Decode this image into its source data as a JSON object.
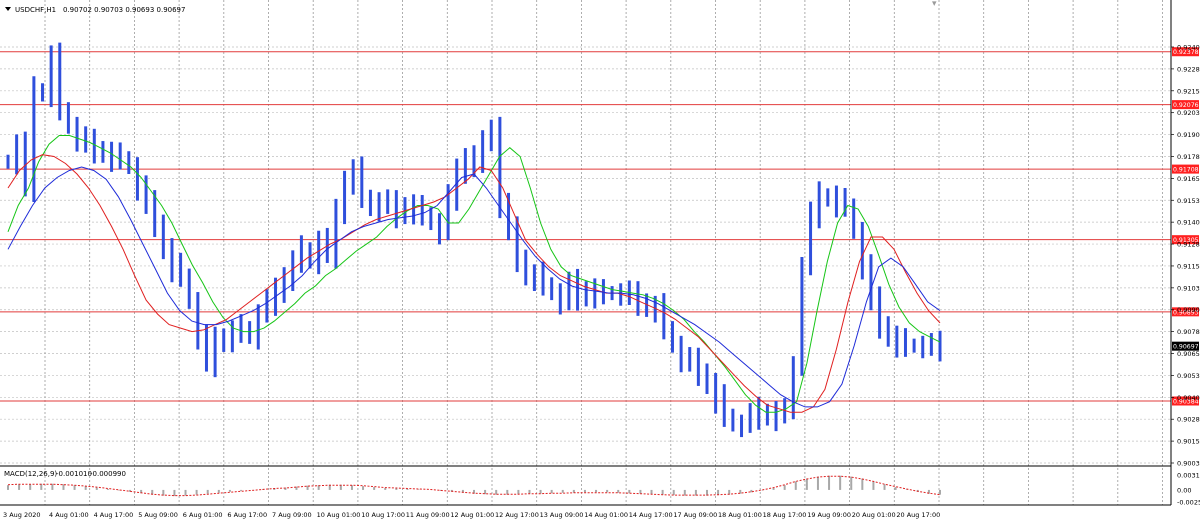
{
  "header": {
    "symbol_tf": "USDCHF,H1",
    "ohlc": "0.90702 0.90703 0.90693 0.90697"
  },
  "macd_header": {
    "label": "MACD(12,26,9)",
    "main": "-0.001010",
    "signal": "-0.000990"
  },
  "colors": {
    "background": "#ffffff",
    "grid": "#c0c0c0",
    "candles": "#2f4fdc",
    "sr_lines": "#e23b3b",
    "sr_label_bg": "#ff2020",
    "current_price_bg": "#000000",
    "ma_fast": "#16c516",
    "ma_mid": "#e02020",
    "ma_slow": "#1e2bd8",
    "macd_hist": "#a8a8a8",
    "macd_signal": "#e02020"
  },
  "chart_data": [
    {
      "type": "line",
      "title": "USDCHF,H1",
      "x_tick_labels": [
        "3 Aug 2020",
        "4 Aug 01:00",
        "4 Aug 17:00",
        "5 Aug 09:00",
        "6 Aug 01:00",
        "6 Aug 17:00",
        "7 Aug 09:00",
        "10 Aug 01:00",
        "10 Aug 17:00",
        "11 Aug 09:00",
        "12 Aug 01:00",
        "12 Aug 17:00",
        "13 Aug 09:00",
        "14 Aug 01:00",
        "14 Aug 17:00",
        "17 Aug 09:00",
        "18 Aug 01:00",
        "18 Aug 17:00",
        "19 Aug 09:00",
        "20 Aug 01:00",
        "20 Aug 17:00"
      ],
      "y_tick_labels": [
        "0.92405",
        "0.92280",
        "0.92155",
        "0.92030",
        "0.91905",
        "0.91780",
        "0.91655",
        "0.91530",
        "0.91405",
        "0.91280",
        "0.91155",
        "0.91030",
        "0.90905",
        "0.90780",
        "0.90655",
        "0.90530",
        "0.90405",
        "0.90280",
        "0.90155",
        "0.90030"
      ],
      "ylim": [
        0.9003,
        0.92405
      ],
      "grid": true,
      "horizontal_levels": [
        0.92378,
        0.92076,
        0.91708,
        0.91305,
        0.90893,
        0.90384
      ],
      "current_price": 0.90697,
      "series": [
        {
          "name": "price",
          "style": "bars",
          "values": [
            0.9175,
            0.9185,
            0.916,
            0.9215,
            0.9215,
            0.9235,
            0.9205,
            0.9195,
            0.9188,
            0.9185,
            0.9182,
            0.918,
            0.9178,
            0.9177,
            0.9172,
            0.916,
            0.915,
            0.914,
            0.9125,
            0.9115,
            0.911,
            0.9095,
            0.9075,
            0.906,
            0.9072,
            0.9075,
            0.9078,
            0.908,
            0.9075,
            0.9088,
            0.9095,
            0.91,
            0.911,
            0.9118,
            0.9125,
            0.9118,
            0.913,
            0.9122,
            0.9145,
            0.9165,
            0.917,
            0.9155,
            0.9148,
            0.9152,
            0.915,
            0.9145,
            0.915,
            0.9148,
            0.9145,
            0.914,
            0.9135,
            0.9155,
            0.9168,
            0.9178,
            0.9175,
            0.9185,
            0.9195,
            0.915,
            0.9135,
            0.912,
            0.911,
            0.911,
            0.9105,
            0.91,
            0.9095,
            0.9105,
            0.9098,
            0.9102,
            0.91,
            0.91,
            0.91,
            0.91,
            0.9098,
            0.9095,
            0.9092,
            0.9092,
            0.908,
            0.907,
            0.9062,
            0.906,
            0.9055,
            0.9048,
            0.904,
            0.903,
            0.9025,
            0.9025,
            0.903,
            0.9032,
            0.903,
            0.9032,
            0.9032,
            0.906,
            0.9115,
            0.9145,
            0.9155,
            0.9155,
            0.9152,
            0.915,
            0.9135,
            0.9115,
            0.9095,
            0.9082,
            0.9075,
            0.9072,
            0.907,
            0.907,
            0.907,
            0.9069,
            0.90697
          ]
        },
        {
          "name": "MA fast",
          "color": "#16c516",
          "values": [
            0.9135,
            0.915,
            0.916,
            0.9175,
            0.9185,
            0.919,
            0.919,
            0.9188,
            0.9186,
            0.9183,
            0.918,
            0.9176,
            0.9172,
            0.9166,
            0.9158,
            0.915,
            0.914,
            0.9128,
            0.9116,
            0.9106,
            0.9095,
            0.9086,
            0.908,
            0.9078,
            0.9078,
            0.908,
            0.9084,
            0.9089,
            0.9094,
            0.91,
            0.9104,
            0.911,
            0.9114,
            0.9119,
            0.9124,
            0.9128,
            0.9132,
            0.9138,
            0.9143,
            0.9147,
            0.915,
            0.915,
            0.9148,
            0.914,
            0.914,
            0.9148,
            0.9158,
            0.9168,
            0.9178,
            0.9183,
            0.9178,
            0.916,
            0.914,
            0.9125,
            0.9115,
            0.911,
            0.9108,
            0.9106,
            0.9104,
            0.9102,
            0.9101,
            0.91,
            0.9099,
            0.9097,
            0.9094,
            0.909,
            0.9085,
            0.9078,
            0.9072,
            0.9065,
            0.9058,
            0.905,
            0.9042,
            0.9036,
            0.9032,
            0.9032,
            0.9034,
            0.9038,
            0.906,
            0.909,
            0.9118,
            0.914,
            0.915,
            0.9148,
            0.9138,
            0.9122,
            0.9105,
            0.9092,
            0.9083,
            0.9078,
            0.9075,
            0.9072
          ]
        },
        {
          "name": "MA mid",
          "color": "#e02020",
          "values": [
            0.916,
            0.917,
            0.9176,
            0.9179,
            0.9178,
            0.9174,
            0.9168,
            0.916,
            0.915,
            0.9138,
            0.9125,
            0.911,
            0.9096,
            0.9088,
            0.9082,
            0.908,
            0.9078,
            0.9079,
            0.9082,
            0.9085,
            0.909,
            0.9095,
            0.91,
            0.9105,
            0.911,
            0.9115,
            0.912,
            0.9124,
            0.9128,
            0.9131,
            0.9135,
            0.9139,
            0.9142,
            0.9144,
            0.9146,
            0.9148,
            0.915,
            0.9152,
            0.9155,
            0.916,
            0.9165,
            0.9172,
            0.917,
            0.916,
            0.9145,
            0.913,
            0.9122,
            0.9115,
            0.911,
            0.9107,
            0.9104,
            0.9102,
            0.91,
            0.91,
            0.9098,
            0.9095,
            0.9092,
            0.9089,
            0.9085,
            0.908,
            0.9075,
            0.9068,
            0.9061,
            0.9054,
            0.9047,
            0.9041,
            0.9036,
            0.9034,
            0.9032,
            0.9032,
            0.9035,
            0.9045,
            0.9068,
            0.9095,
            0.9118,
            0.9132,
            0.9132,
            0.9125,
            0.9112,
            0.91,
            0.909,
            0.9083
          ]
        },
        {
          "name": "MA slow",
          "color": "#1e2bd8",
          "values": [
            0.9125,
            0.9138,
            0.915,
            0.916,
            0.9166,
            0.917,
            0.9172,
            0.917,
            0.9165,
            0.9155,
            0.9142,
            0.9128,
            0.9114,
            0.91,
            0.909,
            0.9084,
            0.9082,
            0.9082,
            0.9084,
            0.9087,
            0.909,
            0.9094,
            0.9099,
            0.9104,
            0.911,
            0.9118,
            0.9125,
            0.913,
            0.9135,
            0.9138,
            0.914,
            0.9142,
            0.9143,
            0.9144,
            0.9146,
            0.915,
            0.9158,
            0.9166,
            0.9168,
            0.916,
            0.915,
            0.914,
            0.913,
            0.9121,
            0.9114,
            0.9108,
            0.9104,
            0.9102,
            0.9101,
            0.91,
            0.91,
            0.9099,
            0.9097,
            0.9094,
            0.909,
            0.9086,
            0.9082,
            0.9077,
            0.9072,
            0.9066,
            0.906,
            0.9054,
            0.9048,
            0.9042,
            0.9038,
            0.9035,
            0.9035,
            0.9038,
            0.9048,
            0.907,
            0.9095,
            0.9115,
            0.912,
            0.9115,
            0.9105,
            0.9095,
            0.909
          ]
        }
      ]
    },
    {
      "type": "bar",
      "title": "MACD(12,26,9)",
      "y_tick_labels": [
        "0.00315",
        "0.00",
        "-0.00255"
      ],
      "ylim": [
        -0.00255,
        0.00315
      ],
      "grid": true,
      "series": [
        {
          "name": "main",
          "style": "histogram",
          "values": [
            0.001,
            0.0012,
            0.0012,
            0.0013,
            0.0013,
            0.0012,
            0.001,
            0.0008,
            0.0005,
            0.0002,
            -0.0001,
            -0.0004,
            -0.0007,
            -0.001,
            -0.0012,
            -0.0013,
            -0.0012,
            -0.001,
            -0.0008,
            -0.0006,
            -0.0004,
            -0.0002,
            0.0,
            0.0002,
            0.0004,
            0.0005,
            0.0007,
            0.0009,
            0.001,
            0.0011,
            0.0011,
            0.001,
            0.0008,
            0.0006,
            0.0004,
            0.0003,
            0.0002,
            0.0001,
            0.0,
            -0.0002,
            -0.0004,
            -0.0006,
            -0.0008,
            -0.0009,
            -0.001,
            -0.001,
            -0.0009,
            -0.0008,
            -0.0008,
            -0.0007,
            -0.0006,
            -0.0006,
            -0.0005,
            -0.0005,
            -0.0005,
            -0.0006,
            -0.0007,
            -0.0008,
            -0.0009,
            -0.001,
            -0.0011,
            -0.0012,
            -0.0012,
            -0.0012,
            -0.0011,
            -0.001,
            -0.0008,
            -0.0005,
            -0.0001,
            0.0004,
            0.001,
            0.0018,
            0.0024,
            0.0028,
            0.003,
            0.003,
            0.0028,
            0.0024,
            0.0018,
            0.0012,
            0.0006,
            0.0001,
            -0.0004,
            -0.0008,
            -0.001
          ]
        },
        {
          "name": "signal",
          "style": "dotted",
          "color": "#e02020",
          "values": [
            0.0011,
            0.0012,
            0.0012,
            0.0012,
            0.0012,
            0.0011,
            0.001,
            0.0008,
            0.0006,
            0.0003,
            0.0,
            -0.0003,
            -0.0006,
            -0.0009,
            -0.0011,
            -0.0012,
            -0.0012,
            -0.0011,
            -0.0009,
            -0.0007,
            -0.0005,
            -0.0003,
            -0.0001,
            0.0001,
            0.0003,
            0.0004,
            0.0006,
            0.0008,
            0.0009,
            0.001,
            0.001,
            0.001,
            0.0009,
            0.0007,
            0.0005,
            0.0004,
            0.0003,
            0.0002,
            0.0001,
            -0.0001,
            -0.0003,
            -0.0005,
            -0.0007,
            -0.0008,
            -0.0009,
            -0.0009,
            -0.0009,
            -0.0008,
            -0.0008,
            -0.0007,
            -0.0007,
            -0.0006,
            -0.0006,
            -0.0006,
            -0.0006,
            -0.0006,
            -0.0007,
            -0.0008,
            -0.0009,
            -0.001,
            -0.0011,
            -0.0011,
            -0.0011,
            -0.0011,
            -0.001,
            -0.0009,
            -0.0007,
            -0.0004,
            0.0,
            0.0005,
            0.0011,
            0.0018,
            0.0023,
            0.0027,
            0.0029,
            0.0029,
            0.0027,
            0.0023,
            0.0018,
            0.0012,
            0.0007,
            0.0002,
            -0.0003,
            -0.0007,
            -0.001
          ]
        }
      ]
    }
  ]
}
